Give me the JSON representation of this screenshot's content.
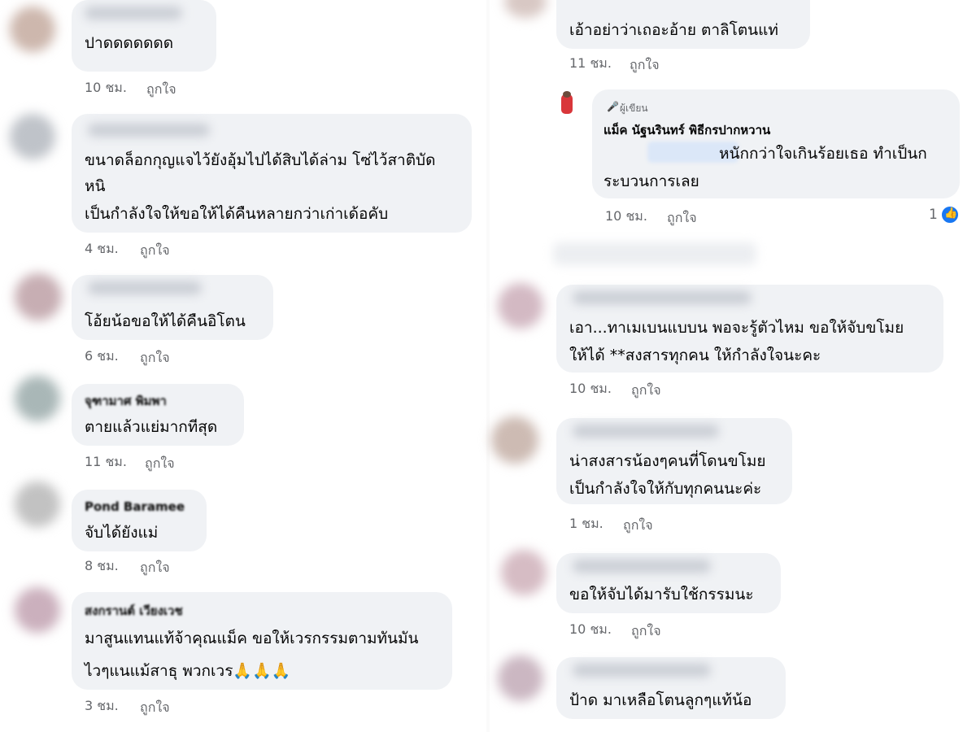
{
  "meta": {
    "like_label": "ถูกใจ"
  },
  "left": [
    {
      "partial_name": "",
      "lines": [
        "ปาดดดดดดด"
      ],
      "time": "10 ชม."
    },
    {
      "partial_name": "",
      "lines": [
        "ขนาดล็อกกุญแจไว้ยังอุ้มไปได้สิบได้ล่าม โซ่ไว้สาติบัด",
        "หนิ",
        "เป็นกำลังใจให้ขอให้ได้คืนหลายกว่าเก่าเด้อคับ"
      ],
      "time": "4 ชม."
    },
    {
      "partial_name": "",
      "lines": [
        "โอ้ยน้อขอให้ได้คืนอิโตน"
      ],
      "time": "6 ชม."
    },
    {
      "partial_name": "จุฑามาศ พิมพา",
      "lines": [
        "ตายแล้วแย่มากทีสุด"
      ],
      "time": "11 ชม."
    },
    {
      "partial_name": "Pond Baramee",
      "lines": [
        "จับได้ยังแม่"
      ],
      "time": "8 ชม."
    },
    {
      "partial_name": "สงกรานต์ เวียงเวช",
      "lines": [
        "มาสูนแทนแท้จ้าคุณแม็ค ขอให้เวรกรรมตามทันมัน",
        "ไวๆแนแม้สาธุ พวกเวร🙏🙏🙏"
      ],
      "time": "3 ชม."
    }
  ],
  "right": [
    {
      "lines": [
        "เอ้าอย่าว่าเถอะอ้าย ตาลิโตนแท่"
      ],
      "time": "11 ชม."
    },
    {
      "author_tag": "ผู้เขียน",
      "author_name": "แม็ค นัฐนรินทร์ พิธีกรปากหวาน",
      "lines": [
        "หนักกว่าใจเกินร้อยเธอ ทำเป็นก",
        "ระบวนการเลย"
      ],
      "time": "10 ชม.",
      "reaction_count": "1"
    },
    {
      "lines": [
        "เอา...ทาเมเบนแบบน พอจะรู้ตัวไหม ขอให้จับขโมย",
        "ให้ได้  **สงสารทุกคน ให้กำลังใจนะคะ"
      ],
      "time": "10 ชม."
    },
    {
      "lines": [
        "น่าสงสารน้องๆคนที่โดนขโมย",
        "เป็นกำลังใจให้กับทุกคนนะค่ะ"
      ],
      "time": "1 ชม."
    },
    {
      "lines": [
        "ขอให้จับได้มารับใช้กรรมนะ"
      ],
      "time": "10 ชม."
    },
    {
      "lines": [
        "ป้าด  มาเหลือโตนลูกๆแท้น้อ"
      ],
      "time": ""
    }
  ],
  "colors": {
    "bubble": "#f0f2f5",
    "meta": "#65676b",
    "text": "#050505",
    "like_blue": "#1877f2"
  }
}
